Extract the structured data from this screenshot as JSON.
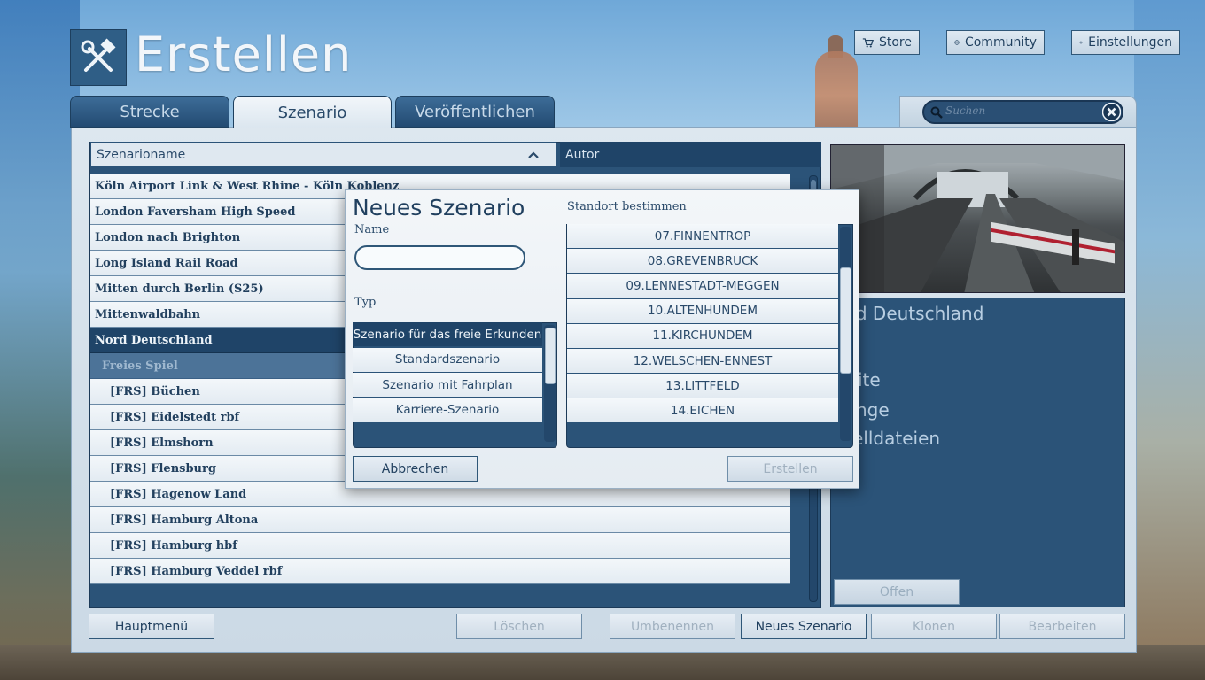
{
  "header": {
    "title": "Erstellen",
    "store_label": "Store",
    "community_label": "Community",
    "settings_label": "Einstellungen"
  },
  "tabs": [
    {
      "label": "Strecke",
      "active": false
    },
    {
      "label": "Szenario",
      "active": true
    },
    {
      "label": "Veröffentlichen",
      "active": false
    }
  ],
  "search": {
    "placeholder": "Suchen"
  },
  "list": {
    "col_name": "Szenarioname",
    "col_author": "Autor",
    "rows": [
      {
        "label": "Köln Airport Link & West Rhine - Köln Koblenz",
        "kind": "light"
      },
      {
        "label": "London Faversham High Speed",
        "kind": "light"
      },
      {
        "label": "London nach Brighton",
        "kind": "light"
      },
      {
        "label": "Long Island Rail Road",
        "kind": "light"
      },
      {
        "label": "Mitten durch Berlin (S25)",
        "kind": "light"
      },
      {
        "label": "Mittenwaldbahn",
        "kind": "light"
      },
      {
        "label": "Nord Deutschland",
        "kind": "selected"
      },
      {
        "label": "Freies Spiel",
        "kind": "group"
      },
      {
        "label": "[FRS] Büchen",
        "kind": "sub"
      },
      {
        "label": "[FRS] Eidelstedt rbf",
        "kind": "sub"
      },
      {
        "label": "[FRS] Elmshorn",
        "kind": "sub"
      },
      {
        "label": "[FRS] Flensburg",
        "kind": "sub"
      },
      {
        "label": "[FRS] Hagenow Land",
        "kind": "sub"
      },
      {
        "label": "[FRS] Hamburg Altona",
        "kind": "sub"
      },
      {
        "label": "[FRS] Hamburg hbf",
        "kind": "sub"
      },
      {
        "label": "[FRS] Hamburg Veddel rbf",
        "kind": "sub"
      }
    ]
  },
  "info": {
    "route_title": "rd Deutschland",
    "line1": "ite",
    "line2": "nge",
    "line3": "elldateien",
    "open_label": "Offen"
  },
  "bottom": {
    "main_menu": "Hauptmenü",
    "delete": "Löschen",
    "rename": "Umbenennen",
    "new_scenario": "Neues Szenario",
    "clone": "Klonen",
    "edit": "Bearbeiten"
  },
  "modal": {
    "title": "Neues Szenario",
    "name_label": "Name",
    "name_value": "",
    "type_label": "Typ",
    "types": [
      {
        "label": "Szenario für das freie Erkunden",
        "selected": true
      },
      {
        "label": "Standardszenario",
        "selected": false
      },
      {
        "label": "Szenario mit Fahrplan",
        "selected": false
      },
      {
        "label": "Karriere-Szenario",
        "selected": false
      }
    ],
    "location_label": "Standort bestimmen",
    "locations": [
      "07.FINNENTROP",
      "08.GREVENBRUCK",
      "09.LENNESTADT-MEGGEN",
      "10.ALTENHUNDEM",
      "11.KIRCHUNDEM",
      "12.WELSCHEN-ENNEST",
      "13.LITTFELD",
      "14.EICHEN"
    ],
    "cancel_label": "Abbrechen",
    "create_label": "Erstellen"
  },
  "colors": {
    "panel_blue": "#2b5378",
    "selected_blue": "#1f4468",
    "light_row": "#eef3f7"
  }
}
